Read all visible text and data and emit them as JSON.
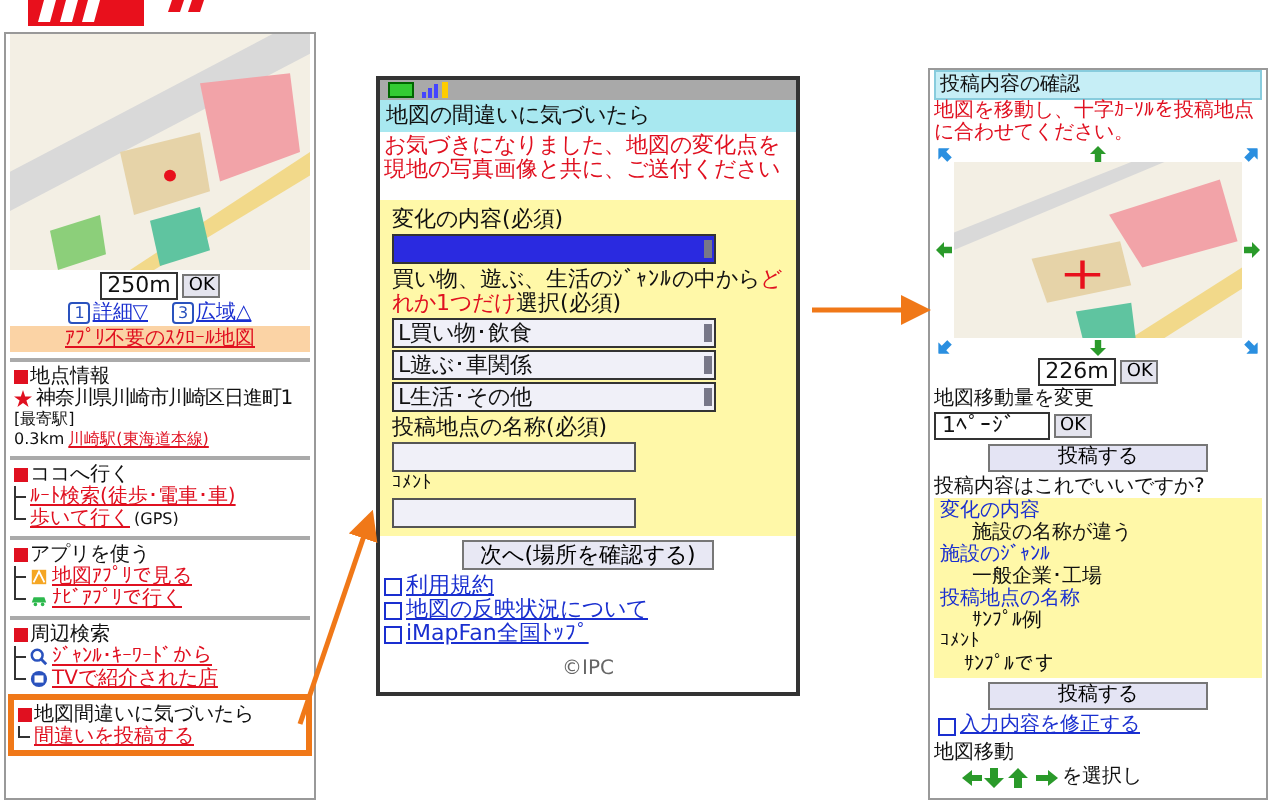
{
  "left_screen": {
    "scale": {
      "value": "250m",
      "button": "OK"
    },
    "zoom_links": [
      {
        "key": "1",
        "label": "詳細▽"
      },
      {
        "key": "3",
        "label": "広域△"
      }
    ],
    "scroll_map_button": "ｱﾌﾟﾘ不要のｽｸﾛｰﾙ地図",
    "sections": [
      {
        "title": "地点情報",
        "highlighted": false,
        "items": [
          {
            "kind": "address",
            "text": "神奈川県川崎市川崎区日進町1"
          },
          {
            "kind": "note",
            "text": "[最寄駅]"
          },
          {
            "kind": "station",
            "distance": "0.3km",
            "text": "川崎駅(東海道本線)"
          }
        ]
      },
      {
        "title": "ココへ行く",
        "highlighted": false,
        "items": [
          {
            "kind": "link",
            "text": "ﾙｰﾄ検索(徒歩･電車･車)",
            "last": false
          },
          {
            "kind": "link",
            "text": "歩いて行く",
            "suffix": "(GPS)",
            "last": true
          }
        ]
      },
      {
        "title": "アプリを使う",
        "highlighted": false,
        "items": [
          {
            "kind": "maplink",
            "text": "地図ｱﾌﾟﾘで見る",
            "last": false
          },
          {
            "kind": "carlink",
            "text": "ﾅﾋﾞｱﾌﾟﾘで行く",
            "last": true
          }
        ]
      },
      {
        "title": "周辺検索",
        "highlighted": false,
        "items": [
          {
            "kind": "searchlink",
            "text": "ｼﾞｬﾝﾙ･ｷｰﾜｰﾄﾞから",
            "last": false
          },
          {
            "kind": "tvlink",
            "text": "TVで紹介された店",
            "last": true
          }
        ]
      },
      {
        "title": "地図間違いに気づいたら",
        "highlighted": true,
        "items": [
          {
            "kind": "link",
            "text": "間違いを投稿する",
            "last": true
          }
        ]
      }
    ]
  },
  "middle_screen": {
    "title": "地図の間違いに気づいたら",
    "notice": "お気づきになりました、地図の変化点を現地の写真画像と共に、ご送付ください",
    "form": [
      {
        "kind": "label",
        "text": "変化の内容(必須)"
      },
      {
        "kind": "select",
        "focused": true
      },
      {
        "kind": "instruction",
        "parts": [
          {
            "text": "買い物、遊ぶ、生活のｼﾞｬﾝﾙの中から",
            "emphasis": false
          },
          {
            "text": "どれか1つだけ",
            "emphasis": true
          },
          {
            "text": "選択(必須)",
            "emphasis": false
          }
        ]
      },
      {
        "kind": "select",
        "value": "L買い物･飲食",
        "focused": false
      },
      {
        "kind": "select",
        "value": "L遊ぶ･車関係",
        "focused": false
      },
      {
        "kind": "select",
        "value": "L生活･その他",
        "focused": false
      },
      {
        "kind": "label",
        "text": "投稿地点の名称(必須)"
      },
      {
        "kind": "input"
      },
      {
        "kind": "small_label",
        "text": "ｺﾒﾝﾄ"
      },
      {
        "kind": "input"
      }
    ],
    "button": "次へ(場所を確認する)",
    "links": [
      "利用規約",
      "地図の反映状況について",
      "iMapFan全国ﾄｯﾌﾟ"
    ],
    "copyright": "©IPC"
  },
  "right_screen": {
    "title": "投稿内容の確認",
    "notice": "地図を移動し、十字ｶｰｿﾙを投稿地点に合わせてください。",
    "scale": {
      "value": "226m",
      "button": "OK"
    },
    "move_amount": {
      "label": "地図移動量を変更",
      "value": "1ﾍﾟｰｼﾞ",
      "button": "OK"
    },
    "submit_top": "投稿する",
    "question": "投稿内容はこれでいいですか?",
    "summary": [
      {
        "kind": "field",
        "label": "変化の内容",
        "value": "施設の名称が違う"
      },
      {
        "kind": "field",
        "label": "施設のｼﾞｬﾝﾙ",
        "value": "一般企業･工場"
      },
      {
        "kind": "field",
        "label": "投稿地点の名称",
        "value": "ｻﾝﾌﾟﾙ例"
      },
      {
        "kind": "comment",
        "label": "ｺﾒﾝﾄ",
        "value": "ｻﾝﾌﾟﾙです"
      }
    ],
    "submit_bottom": "投稿する",
    "edit_link": "入力内容を修正する",
    "map_move": {
      "title": "地図移動",
      "instruction": "を選択し"
    }
  }
}
